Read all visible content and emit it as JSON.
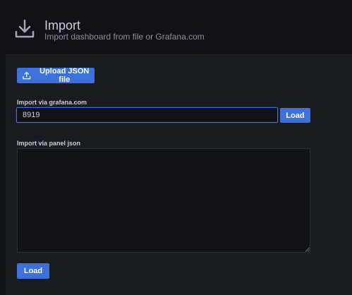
{
  "header": {
    "title": "Import",
    "subtitle": "Import dashboard from file or Grafana.com",
    "icon": "download-icon"
  },
  "upload": {
    "label": "Upload JSON file",
    "icon": "upload-icon"
  },
  "grafana_com": {
    "label": "Import via grafana.com",
    "value": "8919",
    "load_label": "Load"
  },
  "panel_json": {
    "label": "Import via panel json",
    "value": "",
    "load_label": "Load"
  },
  "colors": {
    "background": "#111217",
    "panel": "#181b1f",
    "primary_button": "#3d71d9",
    "focus_border": "#3d71d9",
    "text": "#ccccdc",
    "muted_text": "#8e8e9c"
  }
}
